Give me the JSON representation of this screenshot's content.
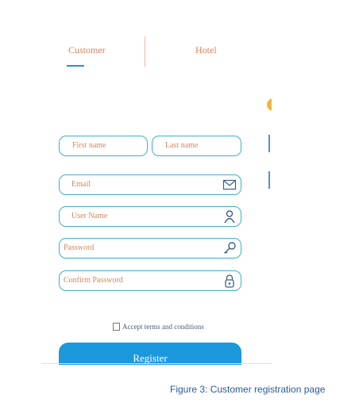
{
  "tabs": {
    "customer": "Customer",
    "hotel": "Hotel"
  },
  "form": {
    "first_name": "First name",
    "last_name": "Last name",
    "email": "Email",
    "user_name": "User Name",
    "password": "Password",
    "confirm_password": "Confirm Password",
    "accept_terms": "Accept terms and conditions",
    "register": "Register"
  },
  "icons": {
    "email": "envelope-icon",
    "user_name": "person-icon",
    "password": "key-icon",
    "confirm_password": "padlock-icon"
  },
  "caption": "Figure 3: Customer registration page",
  "colors": {
    "accent": "#1c99dc",
    "border": "#3db0c7",
    "placeholder": "#d4865e",
    "caption": "#2b5a9a"
  }
}
